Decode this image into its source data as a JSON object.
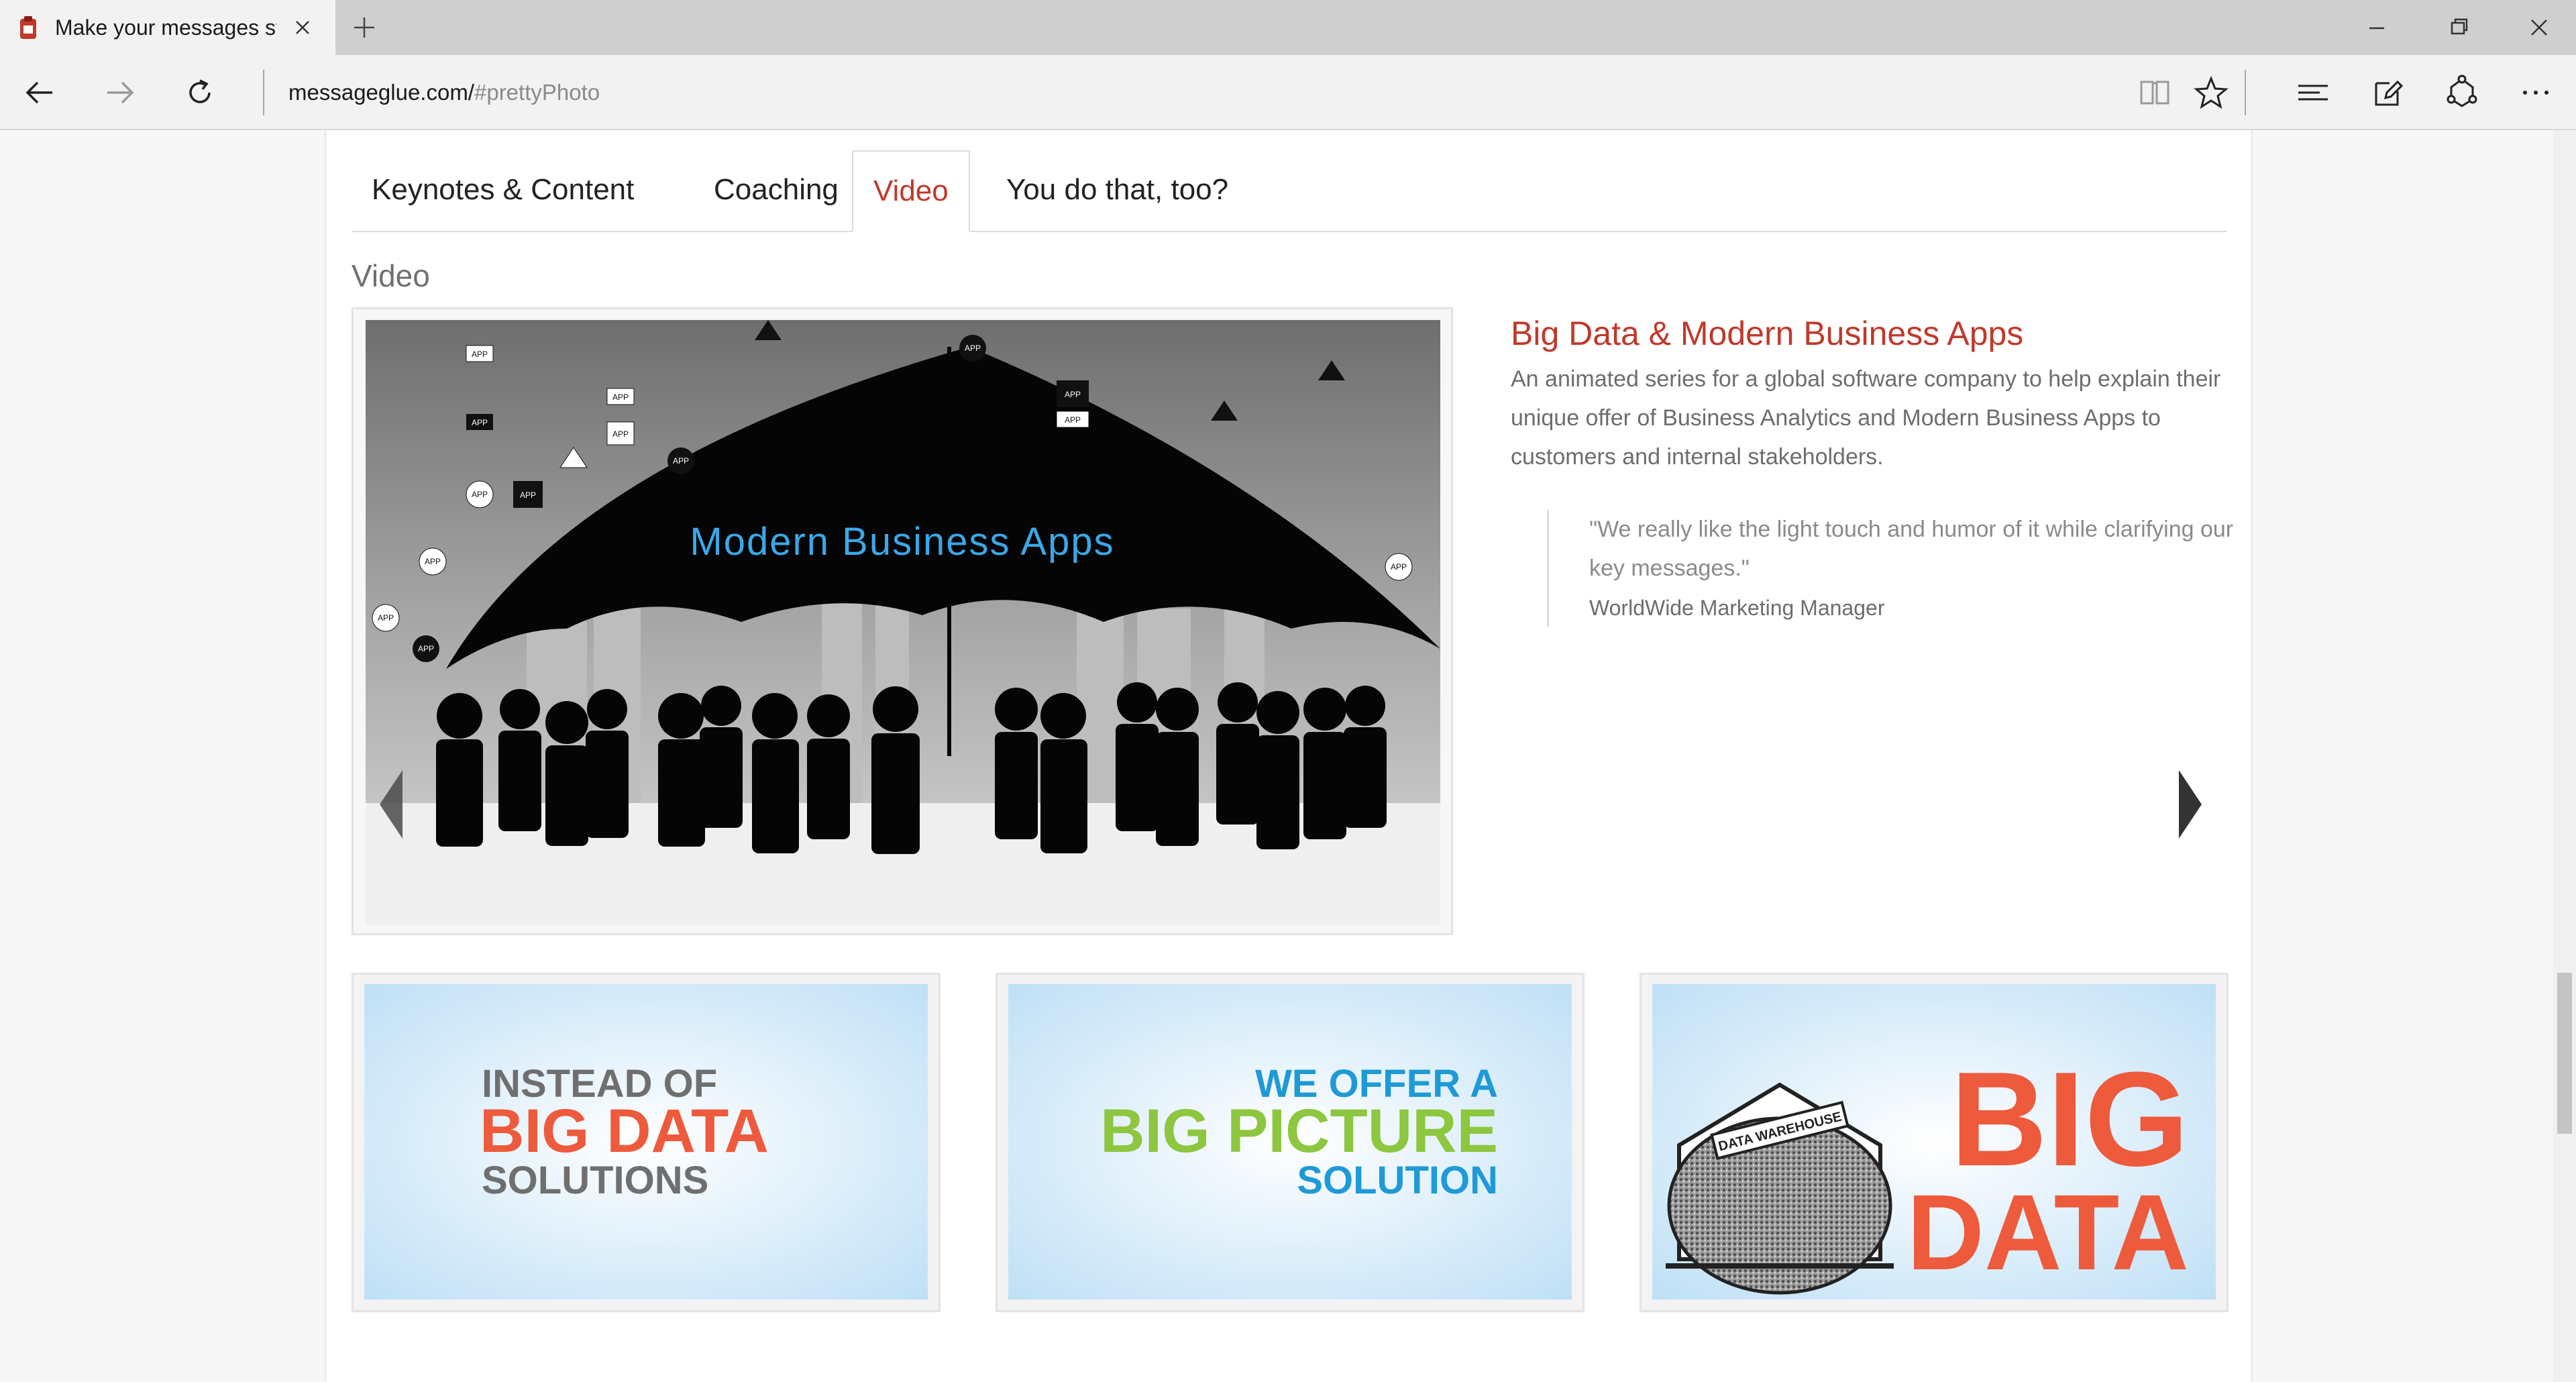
{
  "browser": {
    "tab_title": "Make your messages sti",
    "address_host": "messageglue.com/",
    "address_path": "#prettyPhoto"
  },
  "page": {
    "tabs": [
      {
        "label": "Keynotes & Content"
      },
      {
        "label": "Coaching"
      },
      {
        "label": "Video",
        "active": true
      },
      {
        "label": "You do that, too?"
      }
    ],
    "section_title": "Video",
    "feature": {
      "image_text": "Modern Business Apps",
      "title": "Big Data & Modern Business Apps",
      "description": "An animated series for a global software company to help explain their unique offer of Business Analytics and Modern Business Apps to customers and internal stakeholders.",
      "quote": "\"We really like the light touch and humor of it while clarifying our key messages.\"",
      "quote_author": "WorldWide Marketing Manager"
    },
    "thumbnails": [
      {
        "line1": "INSTEAD OF",
        "line2": "BIG DATA",
        "line3": "SOLUTIONS"
      },
      {
        "line1": "WE OFFER A",
        "line2": "BIG PICTURE",
        "line3": "SOLUTION"
      },
      {
        "line1": "BIG",
        "line2": "DATA",
        "warehouse_label": "DATA WAREHOUSE"
      }
    ]
  },
  "colors": {
    "accent": "#c0392b",
    "big_data_orange": "#ee5a3c",
    "big_picture_green": "#8dc63f",
    "solution_blue": "#1e9ad6",
    "modern_apps_blue": "#3aa8e8"
  }
}
